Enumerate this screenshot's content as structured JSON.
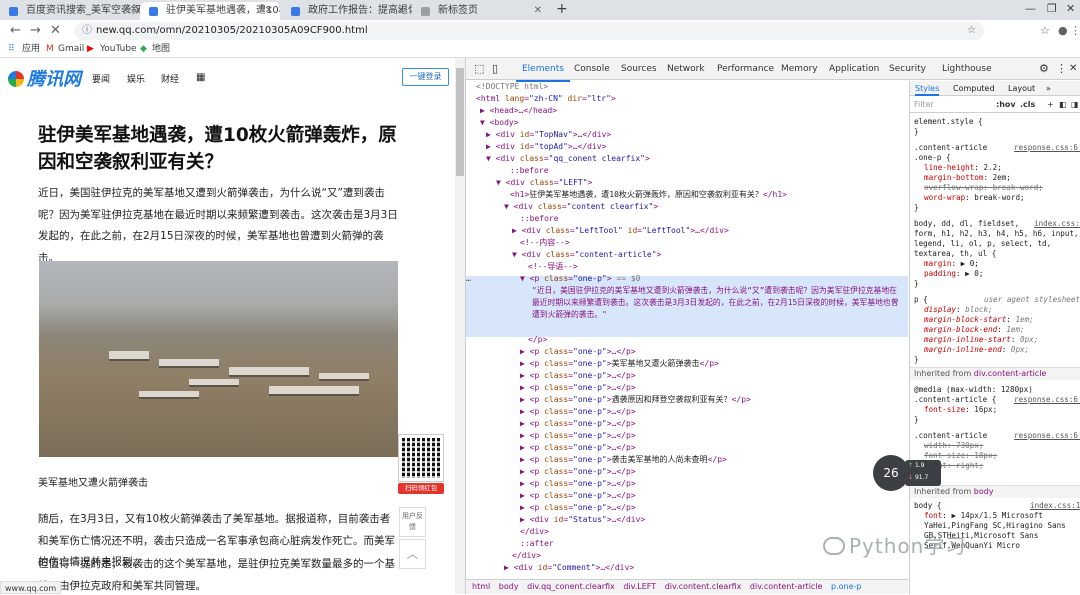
{
  "browser": {
    "tabs": [
      {
        "label": "百度资讯搜索_美军空袭叙利亚",
        "active": false
      },
      {
        "label": "驻伊美军基地遇袭，遭10枚火箭",
        "active": true
      },
      {
        "label": "政府工作报告：提高退休人员基",
        "active": false
      },
      {
        "label": "新标签页",
        "active": false
      }
    ],
    "new_tab": "+",
    "url": "new.qq.com/omn/20210305/20210305A09CF900.html",
    "bookmarks": [
      "应用",
      "Gmail",
      "YouTube",
      "地图"
    ]
  },
  "page": {
    "logo": "腾讯网",
    "nav": [
      "要闻",
      "娱乐",
      "财经"
    ],
    "login": "一键登录",
    "title": "驻伊美军基地遇袭，遭10枚火箭弹轰炸，原因和空袭叙利亚有关？",
    "para1": "近日，美国驻伊拉克的美军基地又遭到火箭弹袭击，为什么说“又”遭到袭击呢？因为美军驻伊拉克基地在最近时期以来频繁遭到袭击。这次袭击是3月3日发起的，在此之前，在2月15日深夜的时候，美军基地也曾遭到火箭弹的袭击。",
    "caption": "美军基地又遭火箭弹袭击",
    "para2": "随后，在3月3日，又有10枚火箭弹袭击了美军基地。据报道称，目前袭击者和美军伤亡情况还不明，袭击只造成一名军事承包商心脏病发作死亡。而美军的伤亡情况并未报到。",
    "para3": "但值得一提的是，被袭击的这个美军基地，是驻伊拉克美军数量最多的一个基地，由伊拉克政府和美军共同管理。",
    "qr_label": "扫码领红包",
    "feedback": "用户反馈",
    "status_url": "www.qq.com"
  },
  "devtools": {
    "tabs": [
      "Elements",
      "Console",
      "Sources",
      "Network",
      "Performance",
      "Memory",
      "Application",
      "Security",
      "Lighthouse"
    ],
    "breadcrumbs": [
      "html",
      "body",
      "div.qq_conent.clearfix",
      "div.LEFT",
      "div.content.clearfix",
      "div.content-article",
      "p.one-p"
    ],
    "styles_tabs": [
      "Styles",
      "Computed",
      "Layout"
    ],
    "filter_placeholder": "Filter",
    "hov": ":hov",
    "cls": ".cls",
    "text_node": "\"近日，美国驻伊拉克的美军基地又遭到火箭弹袭击，为什么说“又”遭到袭击呢？因为美军驻伊拉克基地在最近时期以来频繁遭到袭击。这次袭击是3月3日发起的，在此之前，在2月15日深夜的时候，美军基地也曾遭到火箭弹的袭击。\"",
    "h1_text": "驻伊美军基地遇袭，遭10枚火箭弹轰炸，原因和空袭叙利亚有关？",
    "p_texts": [
      "美军基地又遭火箭弹袭击",
      "遇袭原因和拜登空袭叙利亚有关？",
      "袭击美军基地的人尚未查明"
    ],
    "inherited_1": "div.content-article",
    "inherited_2": "body"
  },
  "overlay": {
    "perf_value": "26",
    "perf_up": "1.9",
    "perf_down": "91.7",
    "watermark": "Python学习"
  }
}
